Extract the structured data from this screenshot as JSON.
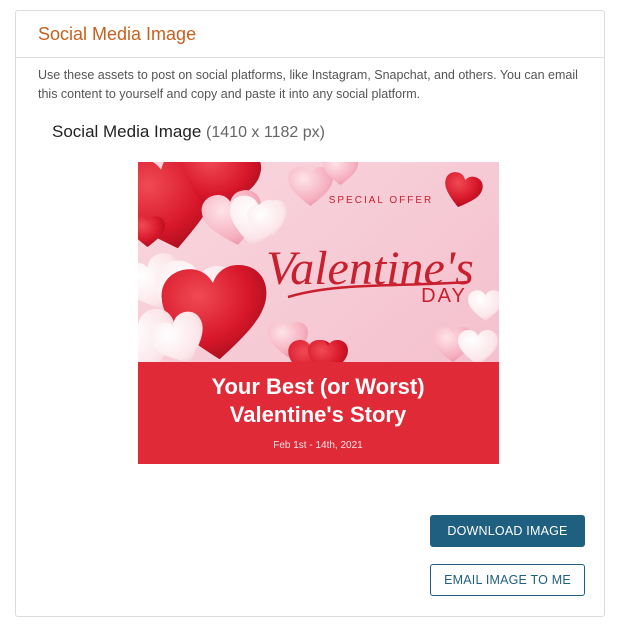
{
  "panel": {
    "title": "Social Media Image",
    "description": "Use these assets to post on social platforms, like Instagram, Snapchat, and others. You can email this content to yourself and copy and paste it into any social platform."
  },
  "image_section": {
    "heading": "Social Media Image",
    "dimensions": "(1410 x 1182 px)"
  },
  "promo_image": {
    "special_offer": "SPECIAL OFFER",
    "script_title": "Valentine's",
    "day": "DAY",
    "headline_line1": "Your Best (or Worst)",
    "headline_line2": "Valentine's Story",
    "dates": "Feb 1st - 14th, 2021",
    "colors": {
      "background_pink": "#f7c9d3",
      "band_red": "#e02a38",
      "script_red": "#c8202e",
      "heart_red": "#d8172a"
    }
  },
  "buttons": {
    "download": "DOWNLOAD IMAGE",
    "email": "EMAIL IMAGE TO ME"
  },
  "colors": {
    "title_orange": "#c8601e",
    "button_blue": "#1f5f7f"
  }
}
